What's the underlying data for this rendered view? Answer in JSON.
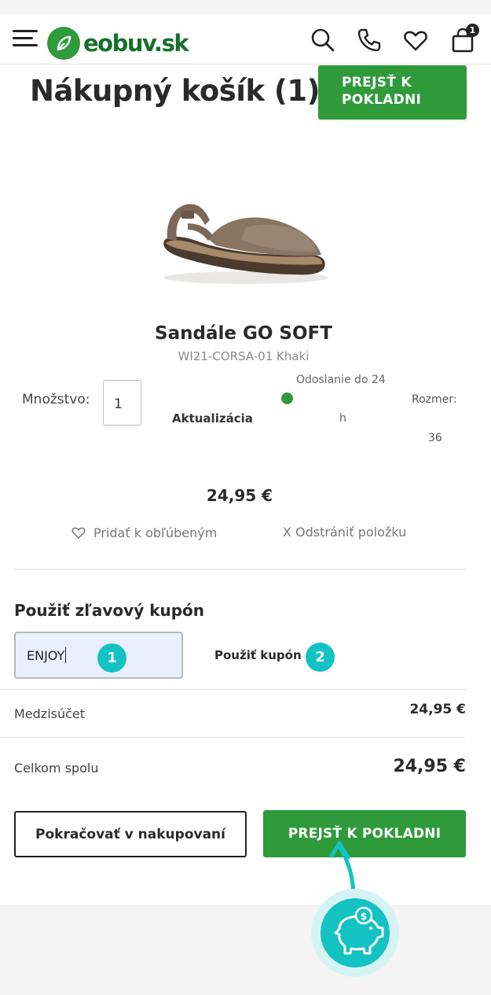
{
  "header": {
    "logo_text": "eobuv",
    "logo_domain": ".sk",
    "cart_count": "1",
    "icons": [
      "menu-icon",
      "search-icon",
      "phone-icon",
      "heart-icon",
      "bag-icon"
    ]
  },
  "page": {
    "title": "Nákupný košík (1)",
    "checkout_top_label": "PREJSŤ K POKLADNI"
  },
  "product": {
    "name": "Sandále GO SOFT",
    "code": "WI21-CORSA-01 Khaki",
    "quantity_label": "Množstvo:",
    "quantity_value": "1",
    "update_label": "Aktualizácia",
    "shipping_line1": "Odoslanie do 24",
    "shipping_line2": "h",
    "size_label": "Rozmer:",
    "size_value": "36",
    "price": "24,95 €",
    "favorite_label": "Pridať k obľúbeným",
    "remove_label": "X Odstrániť položku"
  },
  "coupon": {
    "title": "Použiť zľavový kupón",
    "input_value": "ENJOY",
    "apply_label": "Použiť kupón",
    "badge_1": "1",
    "badge_2": "2"
  },
  "summary": {
    "subtotal_label": "Medzisúčet",
    "subtotal_value": "24,95 €",
    "total_label": "Celkom spolu",
    "total_value": "24,95 €"
  },
  "actions": {
    "continue_label": "Pokračovať v nakupovaní",
    "checkout_label": "PREJSŤ K POKLADNI"
  },
  "colors": {
    "brand_green": "#2e9a3a",
    "logo_green": "#16702a",
    "annotation_teal": "#13c2c2",
    "input_bg": "#e8f0fe"
  }
}
